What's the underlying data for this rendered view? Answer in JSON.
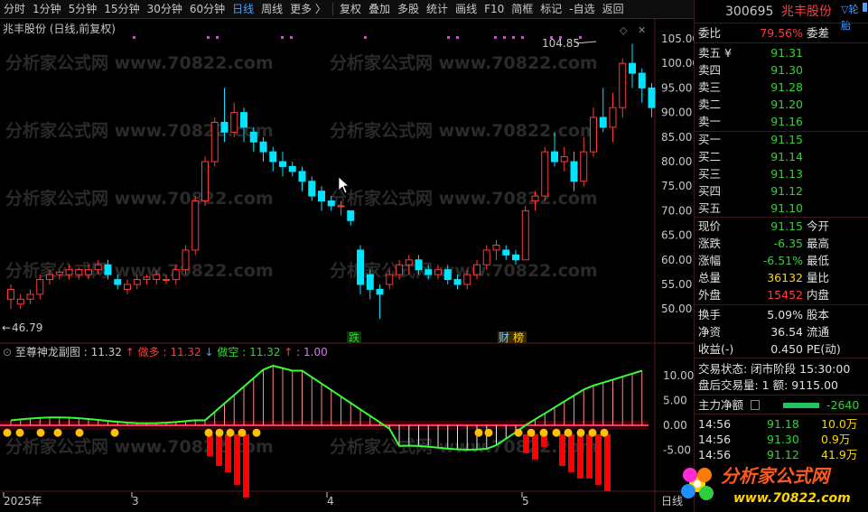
{
  "toolbar": {
    "items": [
      "分时",
      "1分钟",
      "5分钟",
      "15分钟",
      "30分钟",
      "60分钟",
      "日线",
      "周线",
      "更多 〉"
    ],
    "active": "日线",
    "right_items": [
      "复权",
      "叠加",
      "多股",
      "统计",
      "画线",
      "F10",
      "简框",
      "标记",
      "-自选",
      "返回"
    ]
  },
  "chart": {
    "title": "兆丰股份 (日线,前复权)",
    "high_label": "104.85",
    "low_label": "46.79",
    "price_ticks": [
      "105.00",
      "100.00",
      "95.00",
      "90.00",
      "85.00",
      "80.00",
      "75.00",
      "70.00",
      "65.00",
      "60.00",
      "55.00",
      "50.00"
    ],
    "markers": [
      "跌",
      "财"
    ],
    "marker_extra": "榜"
  },
  "indicator": {
    "name": "至尊神龙副图",
    "value": "11.32",
    "zuoduo_label": "做多",
    "zuoduo_value": "11.32",
    "zuokong_label": "做空",
    "zuokong_value": "11.32",
    "ratio": "1.00",
    "ticks": [
      "10.00",
      "5.00",
      "0.00",
      "-5.00"
    ]
  },
  "time_axis": {
    "labels": [
      "2025年",
      "3",
      "4",
      "5"
    ],
    "unit": "日线"
  },
  "right_panel": {
    "code": "300695",
    "name": "兆丰股份",
    "more": "▽轮胎",
    "weibi_label": "委比",
    "weibi": "79.56%",
    "weicha_label": "委差",
    "asks": [
      {
        "label": "卖五 ¥",
        "price": "91.31"
      },
      {
        "label": "卖四",
        "price": "91.30"
      },
      {
        "label": "卖三",
        "price": "91.28"
      },
      {
        "label": "卖二",
        "price": "91.20"
      },
      {
        "label": "卖一",
        "price": "91.16"
      }
    ],
    "bids": [
      {
        "label": "买一",
        "price": "91.15"
      },
      {
        "label": "买二",
        "price": "91.14"
      },
      {
        "label": "买三",
        "price": "91.13"
      },
      {
        "label": "买四",
        "price": "91.12"
      },
      {
        "label": "买五",
        "price": "91.10"
      }
    ],
    "stats": [
      {
        "l1": "现价",
        "v1": "91.15",
        "l2": "今开"
      },
      {
        "l1": "涨跌",
        "v1": "-6.35",
        "l2": "最高"
      },
      {
        "l1": "涨幅",
        "v1": "-6.51%",
        "l2": "最低"
      },
      {
        "l1": "总量",
        "v1": "36132",
        "l2": "量比"
      },
      {
        "l1": "外盘",
        "v1": "15452",
        "l2": "内盘"
      }
    ],
    "stats2": [
      {
        "l1": "换手",
        "v1": "5.09%",
        "l2": "股本"
      },
      {
        "l1": "净资",
        "v1": "36.54",
        "l2": "流通"
      },
      {
        "l1": "收益(-)",
        "v1": "0.450",
        "l2": "PE(动)"
      }
    ],
    "trade_status": "交易状态: 闭市阶段 15:30:00",
    "after_hours": "盘后交易量: 1   额: 9115.00",
    "main_flow_label": "主力净额",
    "main_flow_value": "-2640",
    "ticks": [
      {
        "t": "14:56",
        "p": "91.18",
        "v": "10.0万"
      },
      {
        "t": "14:56",
        "p": "91.30",
        "v": "0.9万"
      },
      {
        "t": "14:56",
        "p": "91.12",
        "v": "41.9万"
      }
    ]
  },
  "watermark": {
    "text": "分析家公式网",
    "url": "www.70822.com",
    "bg_text": "分析家公式网 www.70822.com"
  },
  "colors": {
    "up": "#ff3b3b",
    "down": "#00e5ff",
    "accent": "#4a9cff"
  }
}
